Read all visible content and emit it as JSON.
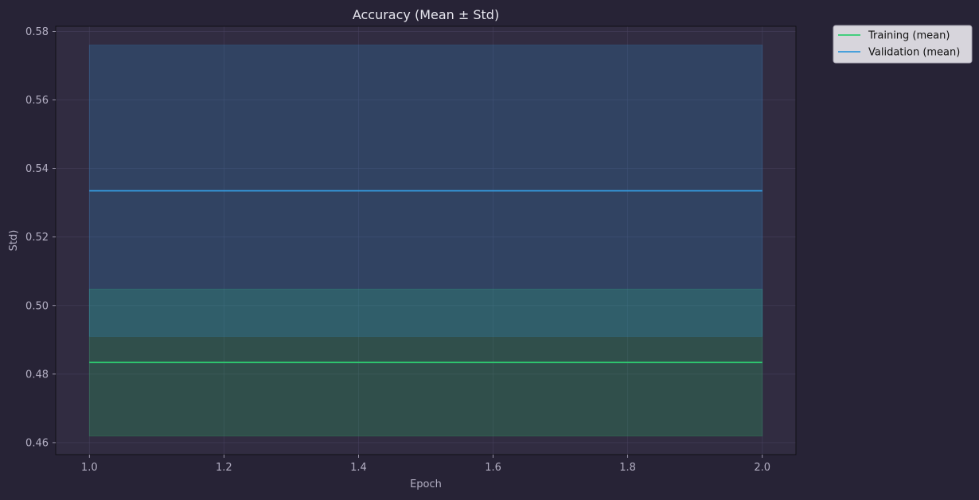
{
  "chart_data": {
    "type": "line",
    "title": "Accuracy (Mean ± Std)",
    "xlabel": "Epoch",
    "ylabel": "Std)",
    "xlim": [
      0.95,
      2.05
    ],
    "ylim": [
      0.4565,
      0.5815
    ],
    "xticks": [
      1.0,
      1.2,
      1.4,
      1.6,
      1.8,
      2.0
    ],
    "xtick_labels": [
      "1.0",
      "1.2",
      "1.4",
      "1.6",
      "1.8",
      "2.0"
    ],
    "yticks": [
      0.46,
      0.48,
      0.5,
      0.52,
      0.54,
      0.56,
      0.58
    ],
    "ytick_labels": [
      "0.46",
      "0.48",
      "0.50",
      "0.52",
      "0.54",
      "0.56",
      "0.58"
    ],
    "grid": true,
    "legend_position": "outside top-right",
    "series": [
      {
        "name": "Training (mean)",
        "color": "#2ecc71",
        "x": [
          1.0,
          2.0
        ],
        "y": [
          0.4834,
          0.4834
        ],
        "band_lower": [
          0.4619,
          0.4619
        ],
        "band_upper": [
          0.5048,
          0.5048
        ]
      },
      {
        "name": "Validation (mean)",
        "color": "#3498db",
        "x": [
          1.0,
          2.0
        ],
        "y": [
          0.5335,
          0.5335
        ],
        "band_lower": [
          0.491,
          0.491
        ],
        "band_upper": [
          0.576,
          0.576
        ]
      }
    ]
  },
  "colors": {
    "figure_background": "#272336",
    "axes_background": "#312c41",
    "text": "#e6e6ee",
    "tick_text": "#b4b0c4",
    "grid": "#4a4560",
    "legend_background": "#d7d5dc",
    "legend_text": "#111111"
  }
}
